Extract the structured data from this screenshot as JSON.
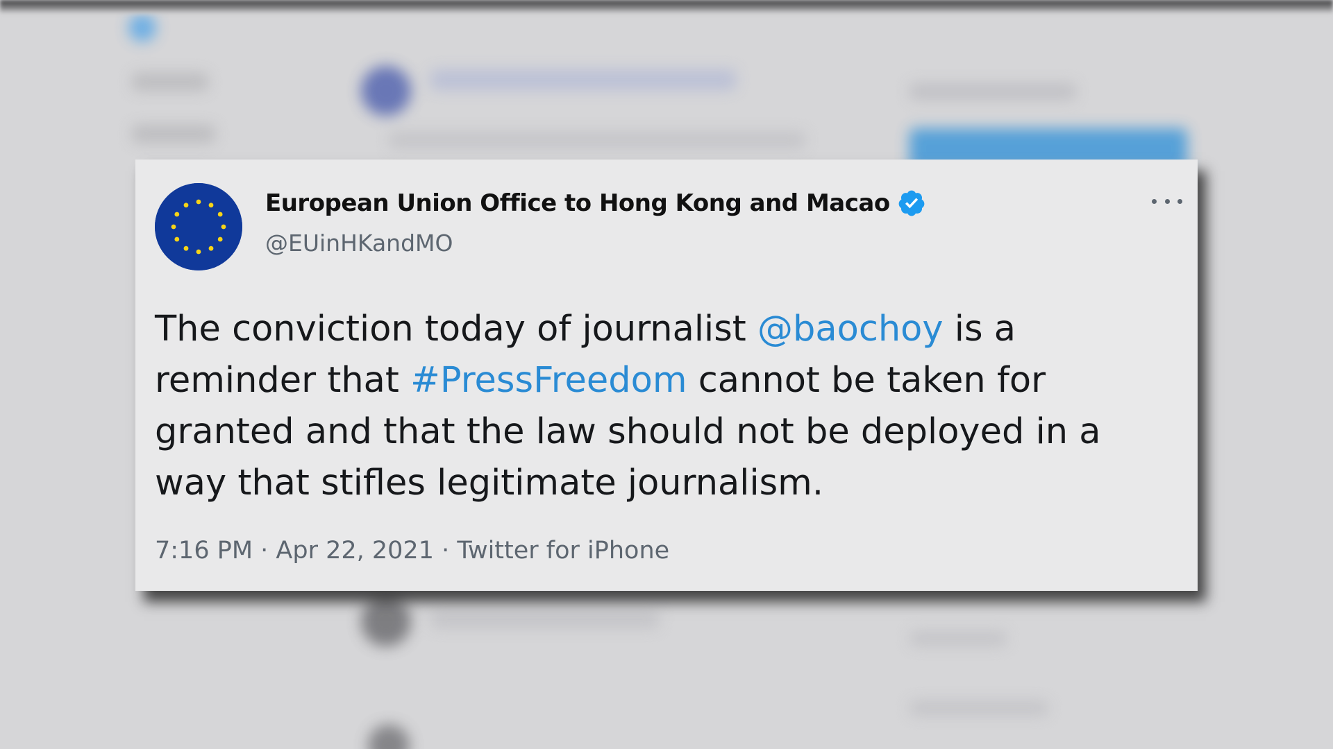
{
  "tweet": {
    "author_name": "European Union Office to Hong Kong and Macao",
    "handle": "@EUinHKandMO",
    "text_1": "The conviction today of journalist ",
    "mention": "@baochoy",
    "text_2": " is a reminder that ",
    "hashtag": "#PressFreedom",
    "text_3": " cannot be taken for granted and that the law should not be deployed in a way that stifles legitimate journalism.",
    "time": "7:16 PM",
    "separator": " · ",
    "date": "Apr 22, 2021",
    "source": "Twitter for iPhone"
  },
  "icons": {
    "avatar": "eu-flag-icon",
    "verified": "verified-badge-icon",
    "more": "more-options-icon"
  },
  "colors": {
    "link": "#2a8bd4",
    "verified": "#1d9bf0",
    "eu_blue": "#10399a",
    "eu_star": "#f7d417"
  }
}
